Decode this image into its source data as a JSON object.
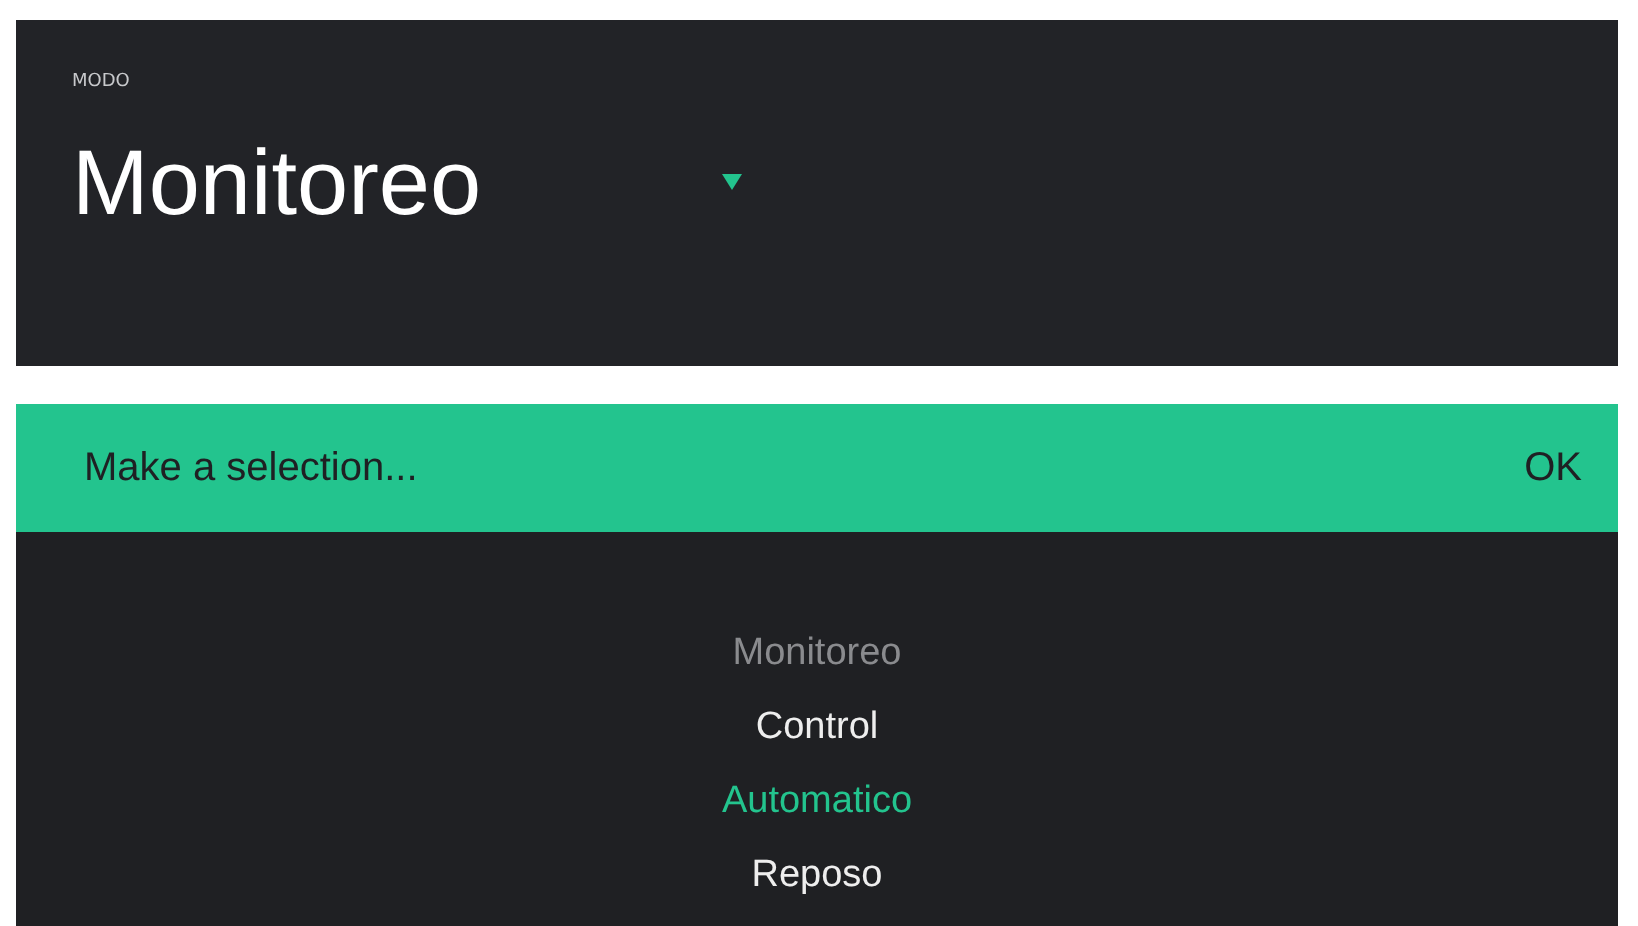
{
  "mode_widget": {
    "label": "MODO",
    "value": "Monitoreo"
  },
  "picker": {
    "prompt": "Make a selection...",
    "ok": "OK",
    "options": [
      {
        "label": "Monitoreo",
        "selected": false,
        "disabled": true
      },
      {
        "label": "Control",
        "selected": false,
        "disabled": false
      },
      {
        "label": "Automatico",
        "selected": true,
        "disabled": false
      },
      {
        "label": "Reposo",
        "selected": false,
        "disabled": false
      }
    ]
  }
}
